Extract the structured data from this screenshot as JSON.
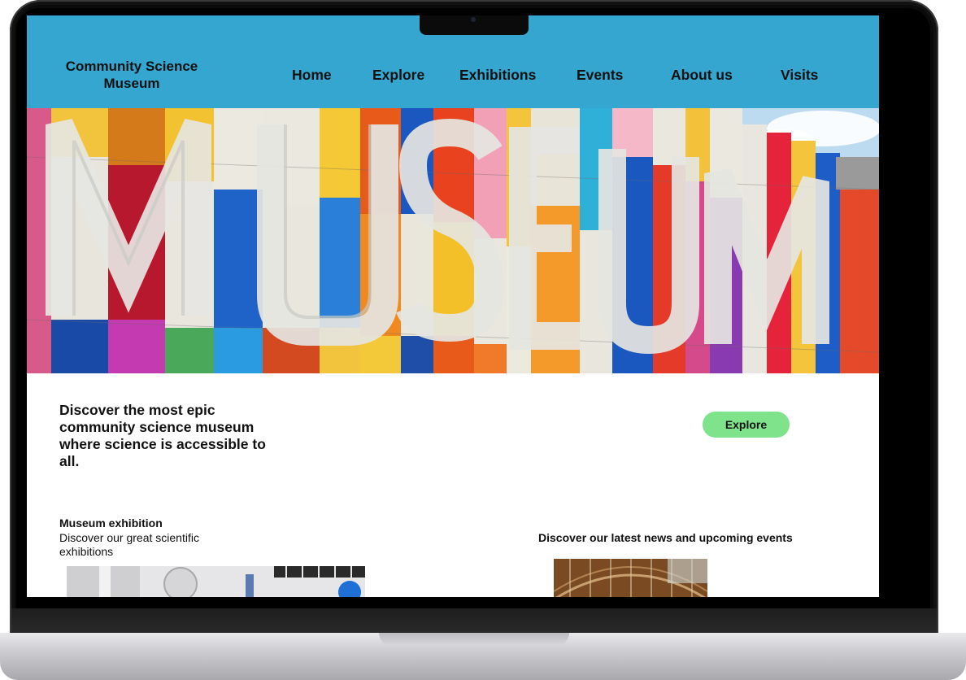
{
  "site": {
    "name": "Community Science Museum"
  },
  "nav": {
    "items": [
      {
        "label": "Home"
      },
      {
        "label": "Explore"
      },
      {
        "label": "Exhibitions"
      },
      {
        "label": "Events"
      },
      {
        "label": "About us"
      },
      {
        "label": "Visits"
      }
    ]
  },
  "hero": {
    "image": "museum-facade-colorful-letters-photo"
  },
  "intro": {
    "tagline": "Discover the most epic community science museum where science is accessible to all.",
    "cta_label": "Explore"
  },
  "exhibition": {
    "title": "Museum exhibition",
    "subtitle": "Discover our great scientific exhibitions",
    "image": "exhibition-hall-photo"
  },
  "news": {
    "title": "Discover our latest news and upcoming events",
    "image": "museum-hall-roof-photo"
  },
  "colors": {
    "header_bg": "#35a6cf",
    "cta_bg": "#7ee38a",
    "text": "#111111"
  }
}
